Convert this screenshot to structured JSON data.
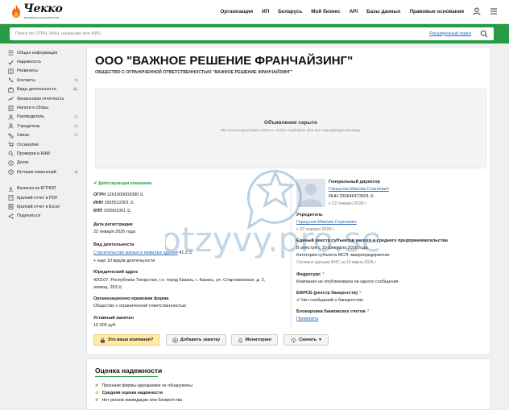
{
  "brand": {
    "name": "Чекко",
    "tagline": "проверка контрагентов"
  },
  "topnav": [
    "Организации",
    "ИП",
    "Беларусь",
    "Мой бизнес",
    "API",
    "Базы данных",
    "Правовые основания"
  ],
  "search": {
    "placeholder": "Поиск по ОГРН, ИНН, названию или ФИО",
    "advanced": "Расширенный поиск"
  },
  "sidebar": {
    "items": [
      {
        "label": "Общая информация",
        "icon": "list-icon",
        "count": ""
      },
      {
        "label": "Надежность",
        "icon": "check-icon",
        "count": ""
      },
      {
        "label": "Реквизиты",
        "icon": "requisites-icon",
        "count": ""
      },
      {
        "label": "Контакты",
        "icon": "phone-icon",
        "count": "3"
      },
      {
        "label": "Виды деятельности",
        "icon": "briefcase-icon",
        "count": "11"
      },
      {
        "label": "Финансовая отчетность",
        "icon": "chart-icon",
        "count": ""
      },
      {
        "label": "Налоги и сборы",
        "icon": "tax-icon",
        "count": ""
      },
      {
        "label": "Руководитель",
        "icon": "person-icon",
        "count": "1"
      },
      {
        "label": "Учредитель",
        "icon": "person-icon",
        "count": "1"
      },
      {
        "label": "Связи",
        "icon": "link-icon",
        "count": "1"
      },
      {
        "label": "Госзакупки",
        "icon": "cart-icon",
        "count": ""
      },
      {
        "label": "Проверки и КНМ",
        "icon": "inspection-icon",
        "count": ""
      },
      {
        "label": "Долги",
        "icon": "debt-icon",
        "count": ""
      },
      {
        "label": "История изменений",
        "icon": "history-icon",
        "count": "5"
      }
    ],
    "actions": [
      {
        "label": "Выписка из ЕГРЮЛ",
        "icon": "download-icon"
      },
      {
        "label": "Краткий отчет в PDF",
        "icon": "pdf-icon"
      },
      {
        "label": "Краткий отчет в Excel",
        "icon": "excel-icon"
      },
      {
        "label": "Поделиться",
        "icon": "share-icon"
      }
    ]
  },
  "company": {
    "title": "ООО \"ВАЖНОЕ РЕШЕНИЕ ФРАНЧАЙЗИНГ\"",
    "full_name": "ОБЩЕСТВО С ОГРАНИЧЕННОЙ ОТВЕТСТВЕННОСТЬЮ \"ВАЖНОЕ РЕШЕНИЕ ФРАНЧАЙЗИНГ\"",
    "ad_title": "Объявление скрыто",
    "ad_text": "Мы используем ваши ответы, чтобы подбирать для вас подходящую рекламу",
    "status": "Действующая компания",
    "ogrn_label": "ОГРН",
    "ogrn": "1261600002080",
    "inn_label": "ИНН",
    "inn": "1655512001",
    "kpp_label": "КПП",
    "kpp": "165501001",
    "reg_label": "Дата регистрации",
    "reg_date": "22 января 2026 года",
    "activity_label": "Вид деятельности",
    "activity": "Строительство жилых и нежилых зданий",
    "activity_code": "41.2",
    "activity_more": "+ еще 10 видов деятельности",
    "address_label": "Юридический адрес",
    "address": "420107, Республика Татарстан, г.о. город Казань, г. Казань, ул. Спартаковская, д. 2,",
    "address_2": "помещ. 253",
    "form_label": "Организационно-правовая форма",
    "form": "Общество с ограниченной ответственностью",
    "capital_label": "Уставный капитал",
    "capital": "10 000 руб.",
    "director_label": "Генеральный директор",
    "director": "Горшунов Максим Сергеевич",
    "director_inn": "ИНН 330646473591",
    "director_since": "с 22 января 2026 г.",
    "founder_label": "Учредитель",
    "founder": "Горшунов Максим Сергеевич",
    "founder_since": "с 22 января 2026 г.",
    "msp_label": "Единый реестр субъектов малого и среднего предпринимательства",
    "msp_status": "В реестре с 10 февраля 2026 года",
    "msp_cat": "Категория субъекта МСП: микропредприятие",
    "msp_source": "Согласно данным ФНС на 10 марта 2026 г.",
    "fedres_label": "Федресурс",
    "fedres": "Компания не опубликовала ни одного сообщения",
    "efrsb_label": "ЕФРСБ (реестр банкротств)",
    "efrsb": "Нет сообщений о банкротстве",
    "block_label": "Блокировка банковских счетов",
    "block": "Проверить"
  },
  "buttons": {
    "own": "Это ваша компания?",
    "note": "Добавить заметку",
    "monitor": "Мониторинг",
    "download": "Скачать"
  },
  "reliability": {
    "title": "Оценка надежности",
    "items": [
      {
        "text": "Признаки фирмы-однодневки не обнаружены",
        "bold": false
      },
      {
        "text": "Средняя оценка надежности",
        "bold": true
      },
      {
        "text": "Нет рисков ликвидации или банкротства",
        "bold": false
      }
    ]
  },
  "watermark": "otzyvy.pro.se",
  "colors": {
    "accent": "#2a9b45",
    "link": "#2a6bb8",
    "warn": "#ffe9a3",
    "logo": "#f26a1b"
  }
}
